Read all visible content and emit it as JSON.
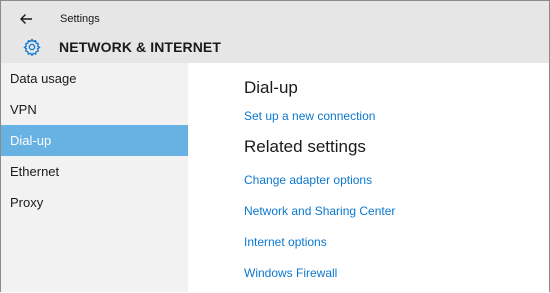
{
  "window": {
    "title": "Settings",
    "header": "NETWORK & INTERNET"
  },
  "sidebar": {
    "items": [
      {
        "label": "Data usage"
      },
      {
        "label": "VPN"
      },
      {
        "label": "Dial-up",
        "selected": true
      },
      {
        "label": "Ethernet"
      },
      {
        "label": "Proxy"
      }
    ]
  },
  "main": {
    "heading": "Dial-up",
    "setup_link": "Set up a new connection",
    "related_heading": "Related settings",
    "related_links": [
      {
        "label": "Change adapter options"
      },
      {
        "label": "Network and Sharing Center"
      },
      {
        "label": "Internet options"
      },
      {
        "label": "Windows Firewall"
      }
    ]
  },
  "colors": {
    "accent": "#68b2e3",
    "link": "#0b78d0",
    "titlebar": "#e6e6e6",
    "sidebar": "#f2f2f2"
  },
  "icons": {
    "back": "back-arrow-icon",
    "header": "gear-icon"
  }
}
